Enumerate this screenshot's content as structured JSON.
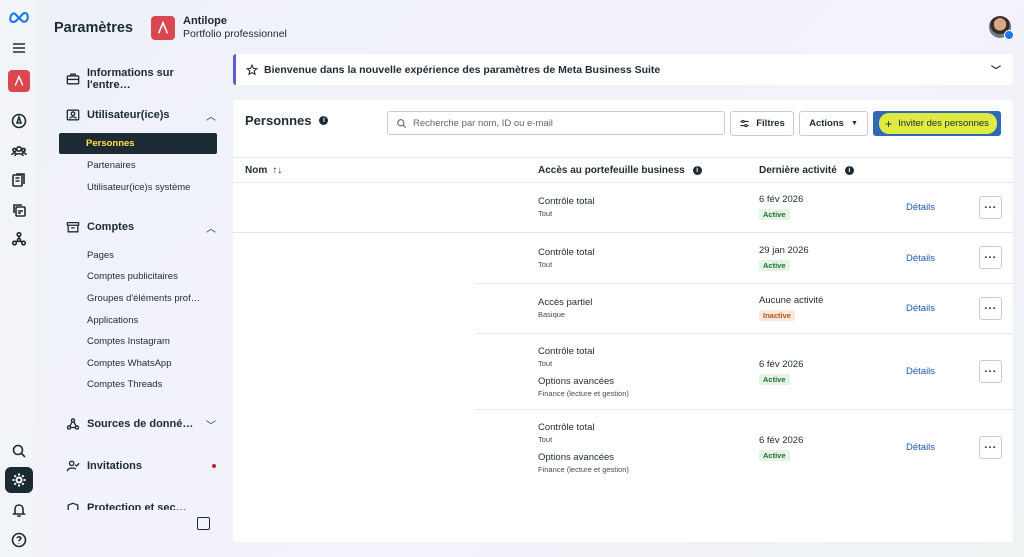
{
  "header": {
    "title": "Paramètres",
    "portfolio_name": "Antilope",
    "portfolio_type": "Portfolio professionnel"
  },
  "rail_icons": [
    "meta-logo-icon",
    "menu-icon",
    "business-logo-icon",
    "compass-icon",
    "people-group-icon",
    "pages-icon",
    "assets-icon",
    "network-icon",
    "search-icon",
    "settings-icon",
    "bell-icon",
    "help-icon"
  ],
  "nav": {
    "sections": [
      {
        "label": "Informations sur l'entre…"
      },
      {
        "label": "Utilisateur(ice)s",
        "items": [
          "Personnes",
          "Partenaires",
          "Utilisateur(ice)s système"
        ]
      },
      {
        "label": "Comptes",
        "items": [
          "Pages",
          "Comptes publicitaires",
          "Groupes d'éléments prof…",
          "Applications",
          "Comptes Instagram",
          "Comptes WhatsApp",
          "Comptes Threads"
        ]
      },
      {
        "label": "Sources de donné…"
      },
      {
        "label": "Invitations"
      },
      {
        "label": "Protection et sec…"
      }
    ],
    "active_item": "Personnes"
  },
  "banner": {
    "text": "Bienvenue dans la nouvelle expérience des paramètres de Meta Business Suite"
  },
  "people": {
    "title": "Personnes",
    "search_placeholder": "Recherche par nom, ID ou e-mail",
    "filters_label": "Filtres",
    "actions_label": "Actions",
    "invite_label": "Inviter des personnes",
    "columns": {
      "name": "Nom",
      "access": "Accès au portefeuille business",
      "last_activity": "Dernière activité"
    },
    "rows": [
      {
        "access": "Contrôle total",
        "access_desc": "Tout",
        "date": "6 fév 2026",
        "status": "Active",
        "details": "Détails"
      },
      {
        "access": "Contrôle total",
        "access_desc": "Tout",
        "date": "29 jan 2026",
        "status": "Active",
        "details": "Détails"
      },
      {
        "access": "Accès partiel",
        "access_desc": "Basique",
        "date": "Aucune activité",
        "status": "Inactive",
        "details": "Détails"
      },
      {
        "access": "Contrôle total",
        "access_desc": "Tout",
        "access2": "Options avancées",
        "access2_desc": "Finance (lecture et gestion)",
        "date": "6 fév 2026",
        "status": "Active",
        "details": "Détails"
      },
      {
        "access": "Contrôle total",
        "access_desc": "Tout",
        "access2": "Options avancées",
        "access2_desc": "Finance (lecture et gestion)",
        "date": "6 fév 2026",
        "status": "Active",
        "details": "Détails"
      }
    ]
  },
  "colors": {
    "dark": "#1c2b33",
    "active_text": "#ffe04a",
    "brand_red": "#d9484f",
    "invite_button": "#2f68b8",
    "highlight": "#e9f23a",
    "link": "#1d5ab3"
  }
}
